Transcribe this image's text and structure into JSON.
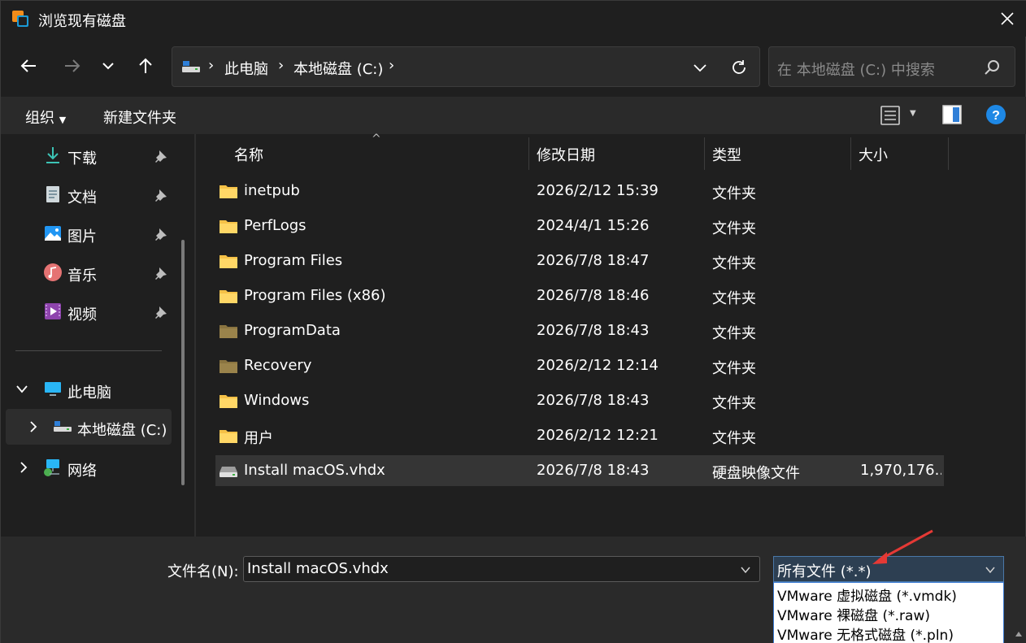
{
  "window": {
    "title": "浏览现有磁盘"
  },
  "address": {
    "breadcrumbs": [
      "此电脑",
      "本地磁盘 (C:)"
    ]
  },
  "search": {
    "placeholder": "在 本地磁盘 (C:) 中搜索"
  },
  "commandbar": {
    "organize": "组织",
    "new_folder": "新建文件夹"
  },
  "sidebar": {
    "quick_access": [
      {
        "label": "下载",
        "icon": "download-icon"
      },
      {
        "label": "文档",
        "icon": "document-icon"
      },
      {
        "label": "图片",
        "icon": "pictures-icon"
      },
      {
        "label": "音乐",
        "icon": "music-icon"
      },
      {
        "label": "视频",
        "icon": "videos-icon"
      }
    ],
    "this_pc": "此电脑",
    "local_disk": "本地磁盘 (C:)",
    "network": "网络"
  },
  "columns": {
    "name": "名称",
    "modified": "修改日期",
    "type": "类型",
    "size": "大小"
  },
  "files": [
    {
      "name": "inetpub",
      "modified": "2026/2/12 15:39",
      "type": "文件夹",
      "size": "",
      "icon": "folder-icon"
    },
    {
      "name": "PerfLogs",
      "modified": "2024/4/1 15:26",
      "type": "文件夹",
      "size": "",
      "icon": "folder-icon"
    },
    {
      "name": "Program Files",
      "modified": "2026/7/8 18:47",
      "type": "文件夹",
      "size": "",
      "icon": "folder-icon"
    },
    {
      "name": "Program Files (x86)",
      "modified": "2026/7/8 18:46",
      "type": "文件夹",
      "size": "",
      "icon": "folder-icon"
    },
    {
      "name": "ProgramData",
      "modified": "2026/7/8 18:43",
      "type": "文件夹",
      "size": "",
      "icon": "folder-hidden-icon"
    },
    {
      "name": "Recovery",
      "modified": "2026/2/12 12:14",
      "type": "文件夹",
      "size": "",
      "icon": "folder-hidden-icon"
    },
    {
      "name": "Windows",
      "modified": "2026/7/8 18:43",
      "type": "文件夹",
      "size": "",
      "icon": "folder-icon"
    },
    {
      "name": "用户",
      "modified": "2026/2/12 12:21",
      "type": "文件夹",
      "size": "",
      "icon": "folder-icon"
    },
    {
      "name": "Install macOS.vhdx",
      "modified": "2026/7/8 18:43",
      "type": "硬盘映像文件",
      "size": "1,970,176...",
      "icon": "disk-image-icon"
    }
  ],
  "bottom": {
    "filename_label": "文件名(N):",
    "filename_value": "Install macOS.vhdx",
    "filetype_value": "所有文件 (*.*)",
    "filetype_options": [
      "VMware 虚拟磁盘 (*.vmdk)",
      "VMware 裸磁盘 (*.raw)",
      "VMware 无格式磁盘 (*.pln)"
    ]
  },
  "colors": {
    "background": "#1f1f1f",
    "commandbar": "#2a2a2a",
    "accent": "#3b7bd4",
    "folder": "#f5c147",
    "annotation_arrow": "#e53935"
  }
}
